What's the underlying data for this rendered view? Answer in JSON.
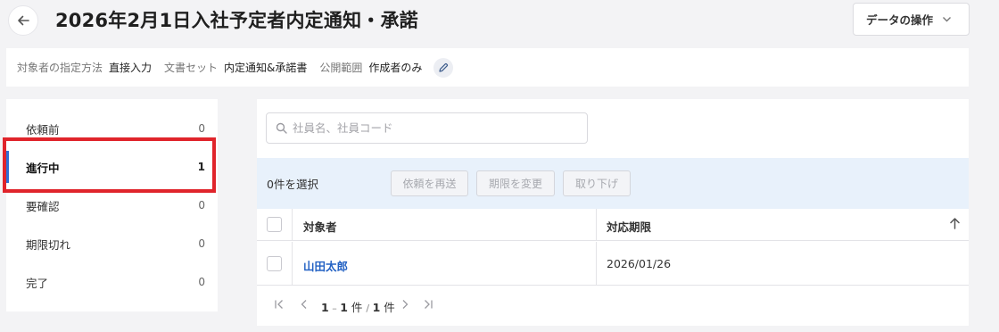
{
  "header": {
    "title": "2026年2月1日入社予定者内定通知・承諾",
    "data_ops_label": "データの操作"
  },
  "settings": {
    "target_method_label": "対象者の指定方法",
    "target_method_value": "直接入力",
    "docset_label": "文書セット",
    "docset_value": "内定通知&承諾書",
    "visibility_label": "公開範囲",
    "visibility_value": "作成者のみ"
  },
  "statuses": [
    {
      "label": "依頼前",
      "count": "0"
    },
    {
      "label": "進行中",
      "count": "1",
      "active": true
    },
    {
      "label": "要確認",
      "count": "0"
    },
    {
      "label": "期限切れ",
      "count": "0"
    },
    {
      "label": "完了",
      "count": "0"
    }
  ],
  "search": {
    "placeholder": "社員名、社員コード"
  },
  "actions": {
    "selected_text": "0件を選択",
    "resend_label": "依頼を再送",
    "change_deadline_label": "期限を変更",
    "withdraw_label": "取り下げ"
  },
  "table": {
    "columns": [
      "対象者",
      "対応期限"
    ],
    "rows": [
      {
        "name": "山田太郎",
        "deadline": "2026/01/26"
      }
    ]
  },
  "pagination": {
    "start": "1",
    "end": "1",
    "unit": "件",
    "total": "1",
    "total_unit": "件"
  },
  "colors": {
    "accent": "#2f6fd4",
    "link": "#2563c4",
    "highlight": "#e0242b",
    "action_bar_bg": "#e8f1fb"
  }
}
